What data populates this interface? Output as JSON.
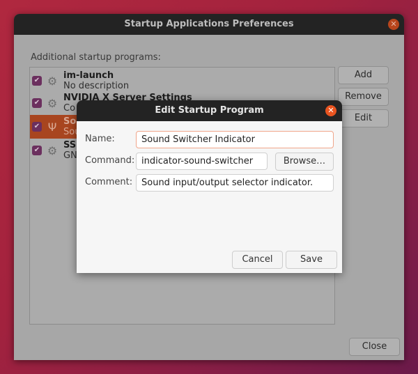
{
  "main_window": {
    "title": "Startup Applications Preferences",
    "list_label": "Additional startup programs:",
    "programs": [
      {
        "name": "im-launch",
        "description": "No description",
        "checked": true,
        "icon": "gears-icon"
      },
      {
        "name": "NVIDIA X Server Settings",
        "description": "Co",
        "checked": true,
        "icon": "gears-icon"
      },
      {
        "name": "Sou",
        "description": "Sou",
        "checked": true,
        "icon": "trident-icon",
        "selected": true
      },
      {
        "name": "SSH",
        "description": "GN",
        "checked": true,
        "icon": "gears-icon"
      }
    ],
    "buttons": {
      "add": "Add",
      "remove": "Remove",
      "edit": "Edit",
      "close": "Close"
    }
  },
  "dialog": {
    "title": "Edit Startup Program",
    "name_label": "Name:",
    "name_value": "Sound Switcher Indicator",
    "command_label": "Command:",
    "command_value": "indicator-sound-switcher",
    "browse": "Browse…",
    "comment_label": "Comment:",
    "comment_value": "Sound input/output selector indicator.",
    "cancel": "Cancel",
    "save": "Save"
  }
}
